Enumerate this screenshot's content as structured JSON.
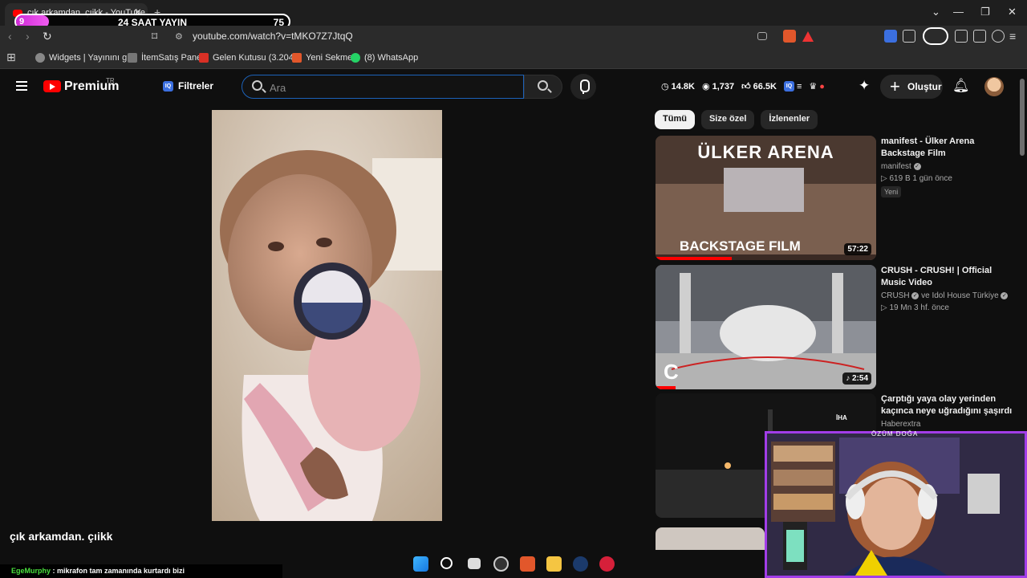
{
  "browser": {
    "tab_title": "çık arkamdan. çıikk - YouTube",
    "new_tab_label": "+",
    "url": "youtube.com/watch?v=tMKO7Z7JtqQ",
    "window_controls": [
      "⌄",
      "—",
      "❐",
      "✕"
    ]
  },
  "stream_overlay": {
    "left_count": "9",
    "center_text": "24 SAAT YAYIN",
    "right_count": "75",
    "progress": 0.12
  },
  "bookmarks": [
    {
      "label": "Widgets | Yayınını g...",
      "icon": "widgets-icon"
    },
    {
      "label": "İtemSatış Panel",
      "icon": "itemsatis-icon"
    },
    {
      "label": "Gelen Kutusu (3.204...",
      "icon": "gmail-icon"
    },
    {
      "label": "Yeni Sekme",
      "icon": "brave-icon"
    },
    {
      "label": "(8) WhatsApp",
      "icon": "whatsapp-icon"
    }
  ],
  "header": {
    "brand": "Premium",
    "country": "TR",
    "filters_label": "Filtreler",
    "search_placeholder": "Ara",
    "stats": {
      "views": "14.8K",
      "watching": "1,737",
      "likes": "66.5K"
    },
    "create_label": "Oluştur"
  },
  "video": {
    "title": "çık arkamdan. çıikk"
  },
  "chips": [
    "Tümü",
    "Size özel",
    "İzlenenler"
  ],
  "recommendations": [
    {
      "title": "manifest - Ülker Arena Backstage Film",
      "channel": "manifest",
      "stats": "619 B  1 gün önce",
      "badge": "Yeni",
      "duration": "57:22",
      "thumb_top_text": "ÜLKER ARENA",
      "thumb_bottom_text": "BACKSTAGE FILM"
    },
    {
      "title": "CRUSH - CRUSH! | Official Music Video",
      "channel": "CRUSH",
      "channel_extra": "ve Idol House Türkiye",
      "stats": "19 Mn  3 hf. önce",
      "duration": "2:54"
    },
    {
      "title": "Çarptığı yaya olay yerinden kaçınca neye uğradığını şaşırdı",
      "channel": "Haberextra",
      "thumb_tag": "İHA"
    }
  ],
  "webcam": {
    "label": "ÖZÜM DOĞA"
  },
  "chat": {
    "user": "EgeMurphy",
    "message": ": mikrafon tam zamanında kurtardı bizi"
  },
  "taskbar_icons": [
    "windows-start-icon",
    "search-icon",
    "task-view-icon",
    "obs-icon",
    "brave-icon",
    "file-explorer-icon",
    "steam-icon",
    "app-icon"
  ]
}
